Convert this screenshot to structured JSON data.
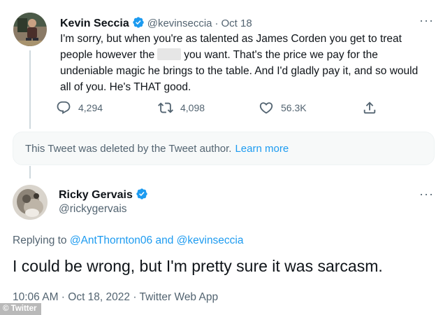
{
  "tweet1": {
    "display_name": "Kevin Seccia",
    "handle": "@kevinseccia",
    "separator": "·",
    "date": "Oct 18",
    "text_before": "I'm sorry, but when you're as talented as James Corden you get to treat people however the",
    "text_after": "you want. That's the price we pay for the undeniable magic he brings to the table. And I'd gladly pay it, and so would all of you. He's THAT good.",
    "more_label": "···",
    "replies": "4,294",
    "retweets": "4,098",
    "likes": "56.3K"
  },
  "deleted": {
    "message": "This Tweet was deleted by the Tweet author.",
    "link": "Learn more"
  },
  "tweet2": {
    "display_name": "Ricky Gervais",
    "handle": "@rickygervais",
    "more_label": "···",
    "replying_prefix": "Replying to",
    "replying_user1": "@AntThornton06",
    "replying_and": "and",
    "replying_user2": "@kevinseccia",
    "text": "I could be wrong, but I'm pretty sure it was sarcasm.",
    "meta": "10:06 AM · Oct 18, 2022 · Twitter Web App"
  },
  "credit": "© Twitter",
  "colors": {
    "verified": "#1d9bf0",
    "link": "#1d9bf0",
    "muted": "#536471",
    "text": "#0f1419"
  }
}
